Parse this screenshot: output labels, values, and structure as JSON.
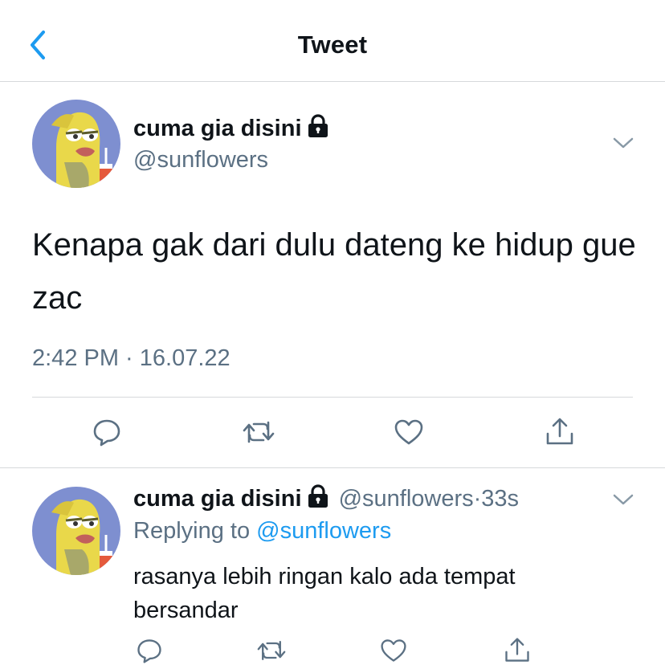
{
  "header": {
    "title": "Tweet"
  },
  "colors": {
    "accent": "#1d9bf0",
    "muted": "#5b7083",
    "divider": "#d6d9db",
    "text": "#0f1419"
  },
  "tweet": {
    "display_name": "cuma gia disini",
    "handle": "@sunflowers",
    "text": "Kenapa gak dari dulu dateng ke hidup gue zac",
    "timestamp": "2:42 PM · 16.07.22",
    "actions": [
      "reply-icon",
      "retweet-icon",
      "like-icon",
      "share-icon"
    ]
  },
  "reply": {
    "display_name": "cuma gia disini",
    "handle": "@sunflowers",
    "separator": "·",
    "time": "33s",
    "replying_prefix": "Replying to",
    "replying_handle": "@sunflowers",
    "text": "rasanya lebih ringan kalo ada tempat bersandar"
  }
}
